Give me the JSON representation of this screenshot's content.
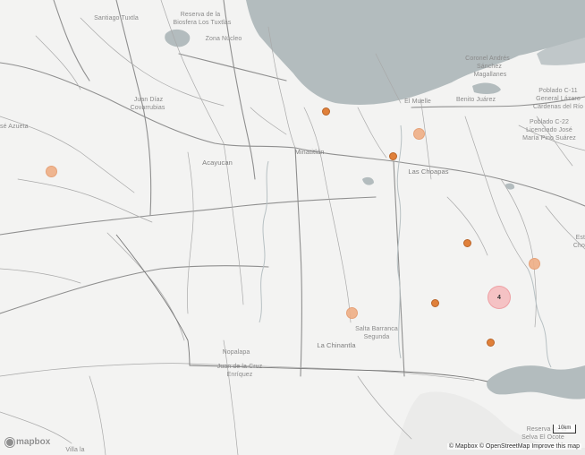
{
  "places": [
    {
      "id": "santiago-tuxtla",
      "text": "Santiago Tuxtla"
    },
    {
      "id": "reserva-biosfera",
      "text": "Reserva de la"
    },
    {
      "id": "reserva-biosfera-2",
      "text": "Biosfera Los Tuxtlas"
    },
    {
      "id": "zona-nucleo",
      "text": "Zona Núcleo"
    },
    {
      "id": "juan-diaz",
      "text": "Juan Díaz"
    },
    {
      "id": "juan-diaz-2",
      "text": "Covarrubias"
    },
    {
      "id": "jose-azueta",
      "text": "sé Azueta"
    },
    {
      "id": "acayucan",
      "text": "Acayucan"
    },
    {
      "id": "minatitlan",
      "text": "Minatitlán"
    },
    {
      "id": "el-muelle",
      "text": "El Muelle"
    },
    {
      "id": "benito-juarez",
      "text": "Benito Juárez"
    },
    {
      "id": "coronel-andres",
      "text": "Coronel Andrés"
    },
    {
      "id": "coronel-andres-2",
      "text": "Sánchez"
    },
    {
      "id": "coronel-andres-3",
      "text": "Magallanes"
    },
    {
      "id": "poblado-c11",
      "text": "Poblado C-11"
    },
    {
      "id": "poblado-c11-2",
      "text": "General Lázaro"
    },
    {
      "id": "poblado-c11-3",
      "text": "Cárdenas del Río"
    },
    {
      "id": "poblado-c22",
      "text": "Poblado C-22"
    },
    {
      "id": "poblado-c22-2",
      "text": "Licenciado José"
    },
    {
      "id": "poblado-c22-3",
      "text": "María Pino Suárez"
    },
    {
      "id": "las-choapas",
      "text": "Las Choapas"
    },
    {
      "id": "est",
      "text": "Est"
    },
    {
      "id": "cho",
      "text": "Cho"
    },
    {
      "id": "salta-barranca",
      "text": "Salta Barranca"
    },
    {
      "id": "salta-barranca-2",
      "text": "Segunda"
    },
    {
      "id": "la-chinantla",
      "text": "La Chinantla"
    },
    {
      "id": "nopalapa",
      "text": "Nopalapa"
    },
    {
      "id": "juan-de-la-cruz",
      "text": "Juan de la Cruz"
    },
    {
      "id": "juan-de-la-cruz-2",
      "text": "Enríquez"
    },
    {
      "id": "reserva-selva",
      "text": "Reserva de la"
    },
    {
      "id": "reserva-selva-2",
      "text": "Selva El Ocote"
    },
    {
      "id": "villa-la",
      "text": "Villa la"
    }
  ],
  "markers": [
    {
      "id": "m1",
      "kind": "small"
    },
    {
      "id": "m2",
      "kind": "light"
    },
    {
      "id": "m3",
      "kind": "small"
    },
    {
      "id": "m4",
      "kind": "light"
    },
    {
      "id": "m5",
      "kind": "small"
    },
    {
      "id": "m6",
      "kind": "light"
    },
    {
      "id": "m7",
      "kind": "small"
    },
    {
      "id": "m8",
      "kind": "light"
    },
    {
      "id": "m9",
      "kind": "small"
    }
  ],
  "cluster": {
    "count": "4"
  },
  "controls": {
    "logo_text": "mapbox",
    "scale_label": "10km",
    "attribution_mapbox": "© Mapbox",
    "attribution_osm": "© OpenStreetMap",
    "attribution_improve": "Improve this map"
  },
  "colors": {
    "land": "#f3f3f2",
    "water": "#b3bcbe",
    "road": "#8f8f8f",
    "marker": "#e0803a",
    "marker_light": "#efaf86",
    "cluster": "#f6b2b4"
  }
}
